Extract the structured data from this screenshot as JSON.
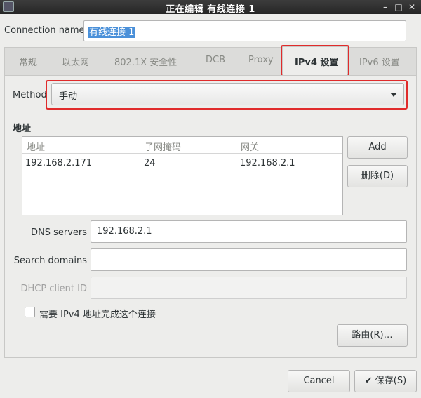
{
  "window": {
    "title": "正在编辑 有线连接 1",
    "controls": {
      "minimize": "–",
      "maximize": "□",
      "close": "✕"
    }
  },
  "connection_name": {
    "label": "Connection name",
    "value": "有线连接 1"
  },
  "tabs": [
    {
      "label": "常规",
      "active": false
    },
    {
      "label": "以太网",
      "active": false
    },
    {
      "label": "802.1X 安全性",
      "active": false
    },
    {
      "label": "DCB",
      "active": false
    },
    {
      "label": "Proxy",
      "active": false
    },
    {
      "label": "IPv4 设置",
      "active": true
    },
    {
      "label": "IPv6 设置",
      "active": false
    }
  ],
  "method": {
    "label": "Method",
    "value": "手动"
  },
  "addresses": {
    "section_title": "地址",
    "columns": [
      "地址",
      "子网掩码",
      "网关"
    ],
    "rows": [
      [
        "192.168.2.171",
        "24",
        "192.168.2.1"
      ]
    ],
    "add_label": "Add",
    "delete_label": "删除(D)"
  },
  "dns": {
    "label": "DNS servers",
    "value": "192.168.2.1"
  },
  "search_domains": {
    "label": "Search domains",
    "value": ""
  },
  "dhcp_client_id": {
    "label": "DHCP client ID",
    "value": ""
  },
  "require_ipv4": {
    "label": "需要 IPv4 地址完成这个连接",
    "checked": false
  },
  "routes_label": "路由(R)…",
  "footer": {
    "cancel_label": "Cancel",
    "save_label": "保存(S)",
    "save_icon": "✔"
  },
  "colors": {
    "highlight": "#e02b2b",
    "selection": "#4a90d9",
    "titlebar": "#2b2b2b"
  }
}
